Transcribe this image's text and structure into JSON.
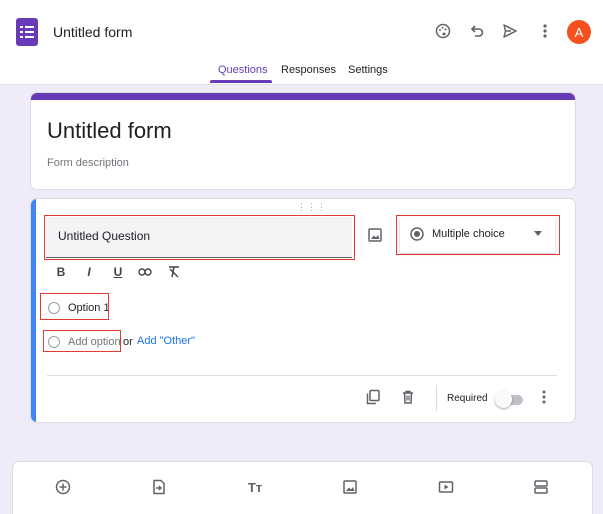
{
  "header": {
    "form_title": "Untitled form",
    "avatar_letter": "A",
    "icons": [
      "palette-icon",
      "undo-icon",
      "send-icon",
      "more-vert-icon"
    ]
  },
  "tabs": [
    {
      "label": "Questions",
      "active": true
    },
    {
      "label": "Responses",
      "active": false
    },
    {
      "label": "Settings",
      "active": false
    }
  ],
  "title_card": {
    "title": "Untitled form",
    "description_placeholder": "Form description"
  },
  "question": {
    "title": "Untitled Question",
    "type": "Multiple choice",
    "options": [
      "Option 1"
    ],
    "add_option": "Add option",
    "or": "or",
    "add_other": "Add \"Other\"",
    "required_label": "Required",
    "required": false
  },
  "toolbar_icons": [
    "add-question-icon",
    "import-questions-icon",
    "add-title-icon",
    "add-image-icon",
    "add-video-icon",
    "add-section-icon"
  ],
  "colors": {
    "accent": "#673ab7",
    "active_question": "#4285f4",
    "highlight_box": "#e53935",
    "avatar": "#f4511e"
  }
}
